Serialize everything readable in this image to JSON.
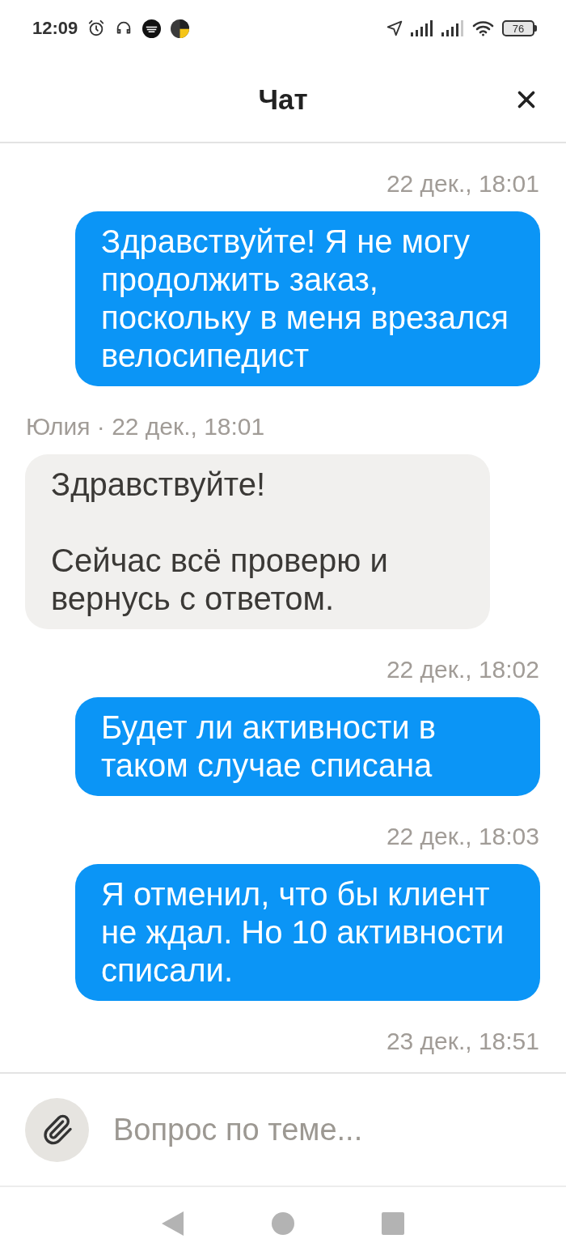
{
  "status_bar": {
    "time": "12:09",
    "battery": "76"
  },
  "header": {
    "title": "Чат"
  },
  "messages": [
    {
      "kind": "timestamp",
      "text": "22 дек., 18:01"
    },
    {
      "kind": "outgoing",
      "text": "Здравствуйте! Я не могу продолжить заказ, поскольку в меня врезался велосипедист"
    },
    {
      "kind": "sender",
      "text": "Юлия · 22 дек., 18:01"
    },
    {
      "kind": "incoming",
      "text": "Здравствуйте!\n\nСейчас всё проверю и вернусь с ответом."
    },
    {
      "kind": "timestamp",
      "text": "22 дек., 18:02"
    },
    {
      "kind": "outgoing",
      "text": "Будет ли активности в таком случае списана"
    },
    {
      "kind": "timestamp",
      "text": "22 дек., 18:03"
    },
    {
      "kind": "outgoing",
      "text": "Я отменил, что бы клиент не ждал. Но 10 активности списали."
    },
    {
      "kind": "timestamp",
      "text": "23 дек., 18:51"
    }
  ],
  "composer": {
    "placeholder": "Вопрос по теме..."
  }
}
